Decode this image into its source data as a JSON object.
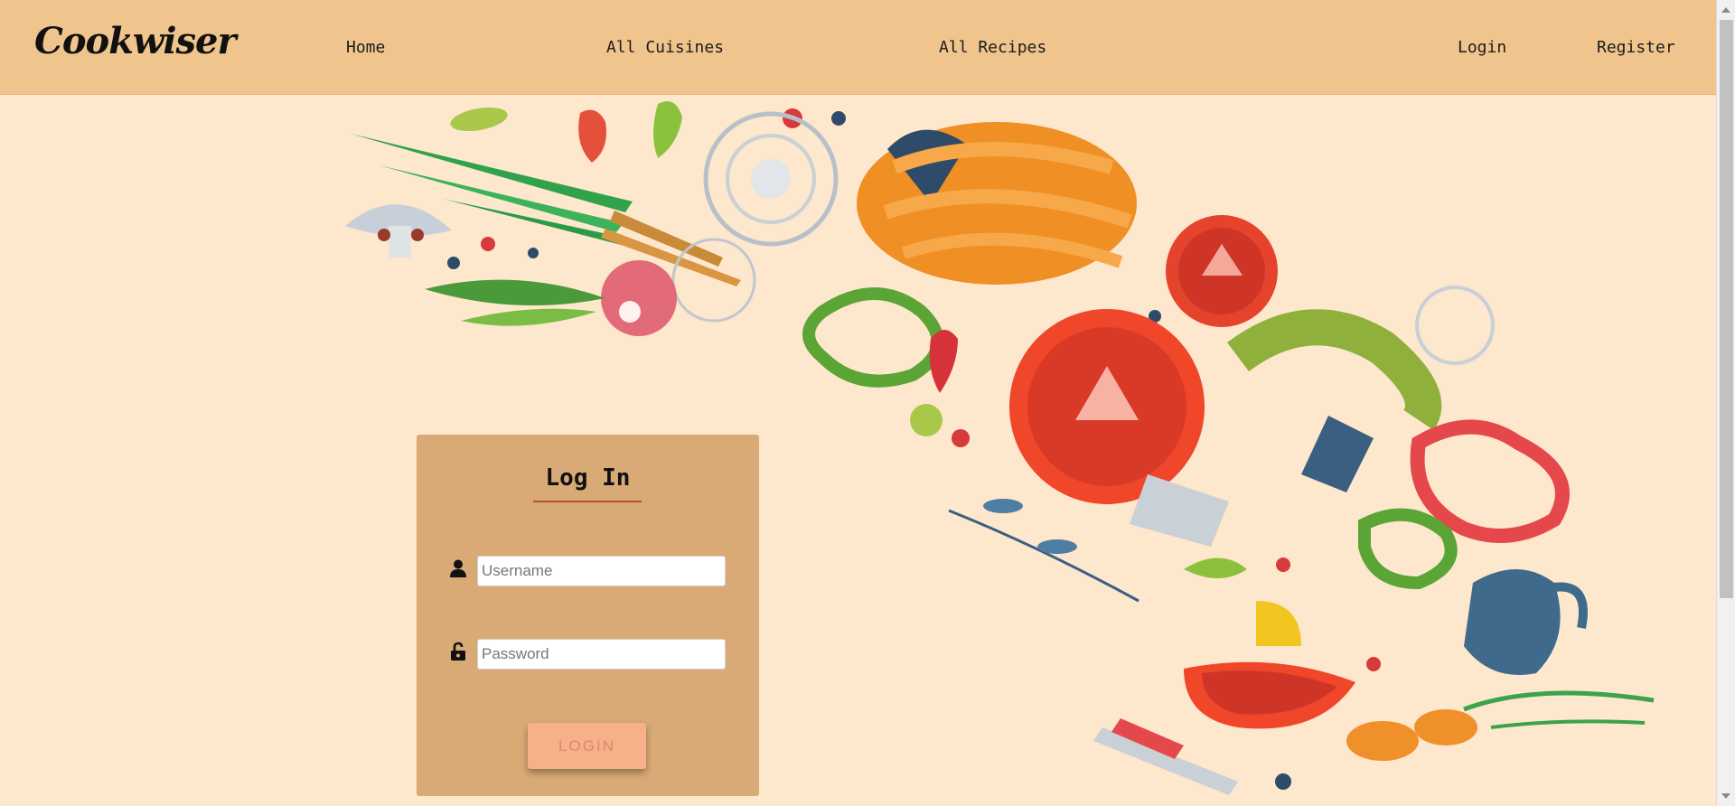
{
  "nav": {
    "brand": "Cookwiser",
    "links": [
      "Home",
      "All Cuisines",
      "All Recipes",
      "Login",
      "Register"
    ]
  },
  "login_form": {
    "title": "Log In",
    "username_placeholder": "Username",
    "password_placeholder": "Password",
    "submit_label": "LOGIN"
  },
  "icons": {
    "username": "user-icon",
    "password": "unlock-icon"
  },
  "colors": {
    "navbar": "#f0c48d",
    "page_background": "#fde7cd",
    "card": "#d9aa76",
    "button": "#f7b08a",
    "title_underline": "#b5523a"
  }
}
